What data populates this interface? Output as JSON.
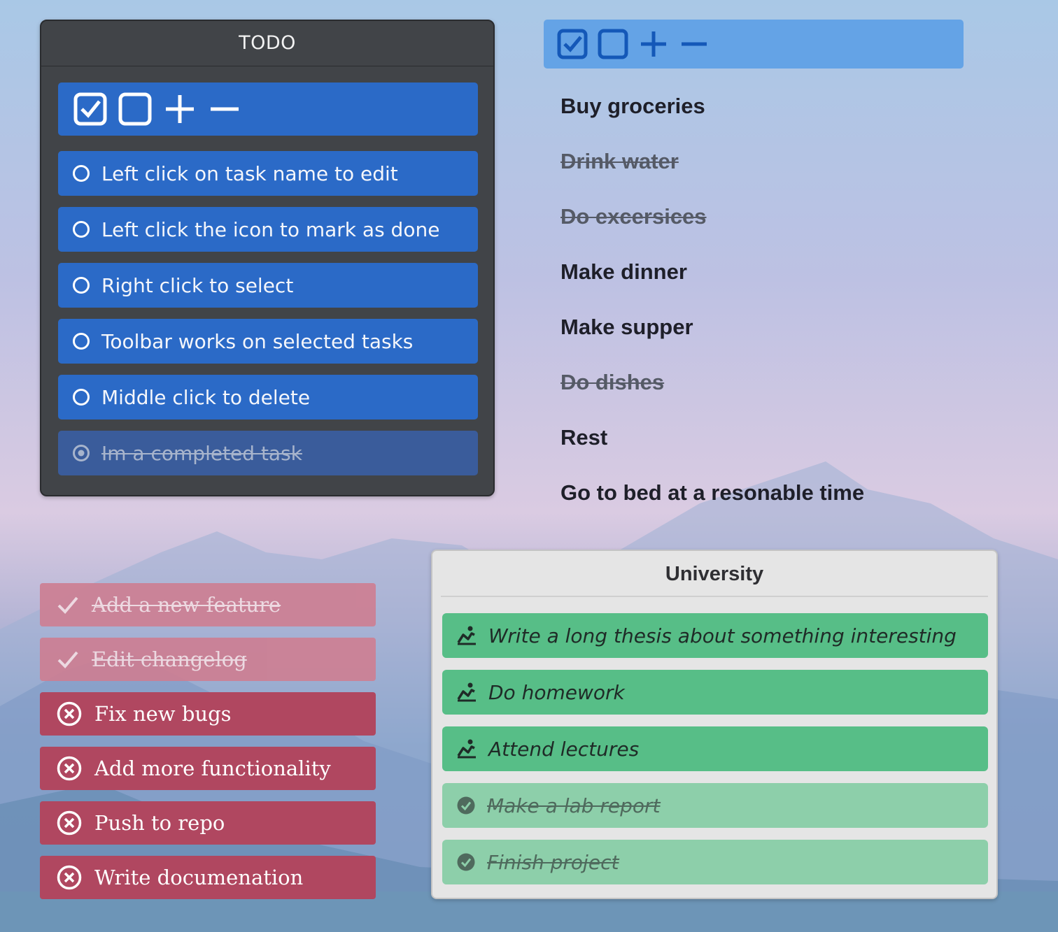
{
  "colors": {
    "todo_bg": "#414448",
    "todo_task": "#2b6ac7",
    "todo_task_done": "#3a5c9b",
    "list_toolbar": "#64a3e6",
    "red_task": "#b04760",
    "red_task_done": "#cd7f93",
    "green_task": "#57be87",
    "green_task_done": "#8dcfaa"
  },
  "todo_widget": {
    "title": "TODO",
    "toolbar_icons": [
      "checkbox-checked-icon",
      "checkbox-empty-icon",
      "plus-icon",
      "minus-icon"
    ],
    "tasks": [
      {
        "label": "Left click on task name to edit",
        "done": false
      },
      {
        "label": "Left click the icon to mark as done",
        "done": false
      },
      {
        "label": "Right click to select",
        "done": false
      },
      {
        "label": "Toolbar works on selected tasks",
        "done": false
      },
      {
        "label": "Middle click to delete",
        "done": false
      },
      {
        "label": "Im a completed task",
        "done": true
      }
    ]
  },
  "list_widget": {
    "toolbar_icons": [
      "checkbox-checked-icon",
      "checkbox-empty-icon",
      "plus-icon",
      "minus-icon"
    ],
    "tasks": [
      {
        "label": "Buy groceries",
        "done": false
      },
      {
        "label": "Drink water",
        "done": true
      },
      {
        "label": "Do excersices",
        "done": true
      },
      {
        "label": "Make dinner",
        "done": false
      },
      {
        "label": "Make supper",
        "done": false
      },
      {
        "label": "Do dishes",
        "done": true
      },
      {
        "label": "Rest",
        "done": false
      },
      {
        "label": "Go to bed at a resonable time",
        "done": false
      }
    ]
  },
  "red_widget": {
    "tasks": [
      {
        "label": "Add a new feature",
        "done": true
      },
      {
        "label": "Edit changelog",
        "done": true
      },
      {
        "label": "Fix new bugs",
        "done": false
      },
      {
        "label": "Add more functionality",
        "done": false
      },
      {
        "label": "Push to repo",
        "done": false
      },
      {
        "label": "Write documenation",
        "done": false
      }
    ]
  },
  "university_widget": {
    "title": "University",
    "tasks": [
      {
        "label": "Write a long thesis about something interesting",
        "done": false
      },
      {
        "label": "Do homework",
        "done": false
      },
      {
        "label": "Attend lectures",
        "done": false
      },
      {
        "label": "Make a lab report",
        "done": true
      },
      {
        "label": "Finish project",
        "done": true
      }
    ]
  }
}
